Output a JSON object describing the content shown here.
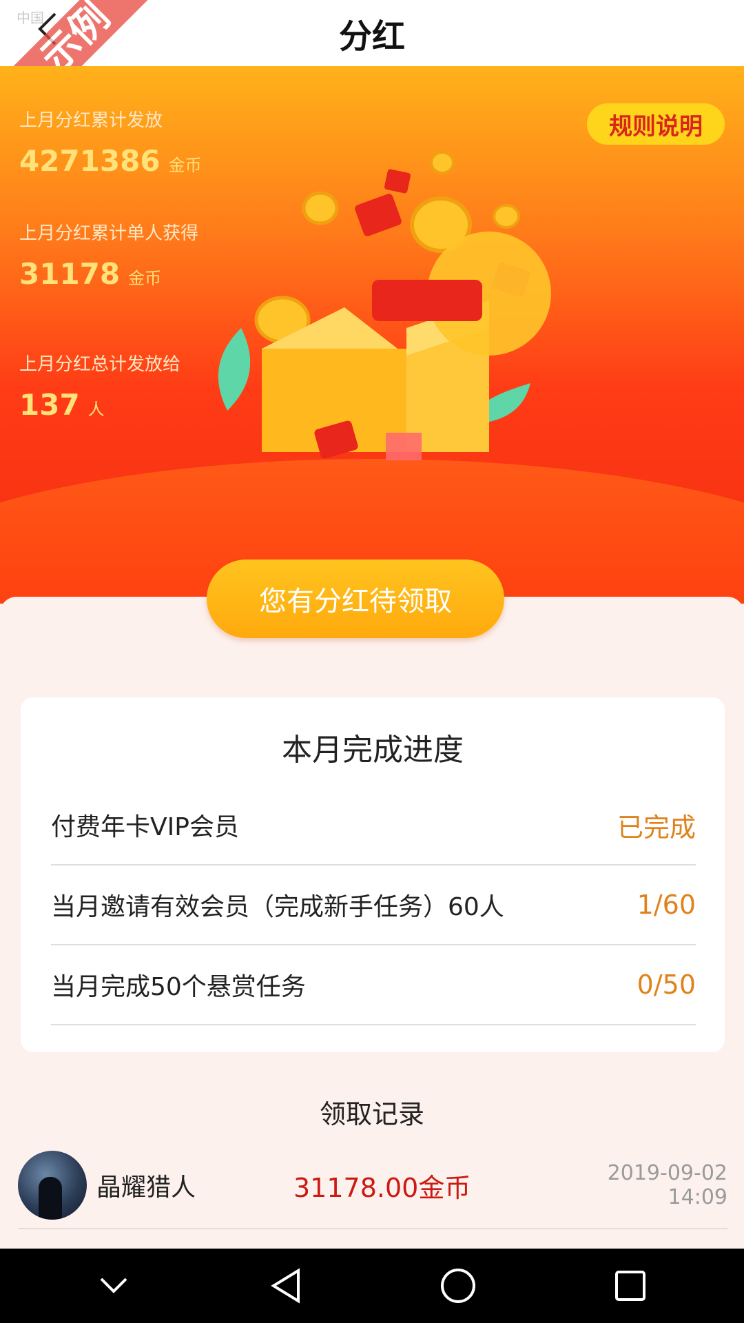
{
  "header": {
    "title": "分红",
    "back_icon": "chevron-left-icon",
    "watermark_text": "示例",
    "watermark_small": "中国"
  },
  "banner": {
    "stats": [
      {
        "label": "上月分红累计发放",
        "value": "4271386",
        "unit": "金币"
      },
      {
        "label": "上月分红累计单人获得",
        "value": "31178",
        "unit": "金币"
      },
      {
        "label": "上月分红总计发放给",
        "value": "137",
        "unit": "人"
      }
    ],
    "rules_label": "规则说明",
    "colors": {
      "gold": "#ffe27a",
      "button": "#ffd51c",
      "rules_text": "#d9261b"
    }
  },
  "claim_button": {
    "label": "您有分红待领取"
  },
  "progress": {
    "title": "本月完成进度",
    "tasks": [
      {
        "name": "付费年卡VIP会员",
        "status": "已完成"
      },
      {
        "name": "当月邀请有效会员（完成新手任务）60人",
        "status": "1/60"
      },
      {
        "name": "当月完成50个悬赏任务",
        "status": "0/50"
      }
    ],
    "status_color": "#e0821c"
  },
  "records": {
    "title": "领取记录",
    "items": [
      {
        "name": "晶耀猎人",
        "amount": "31178.00金币",
        "time": "2019-09-02 14:09"
      }
    ]
  },
  "navbar": {
    "icons": [
      "chevron-down-icon",
      "back-triangle-icon",
      "home-circle-icon",
      "recents-square-icon"
    ]
  }
}
